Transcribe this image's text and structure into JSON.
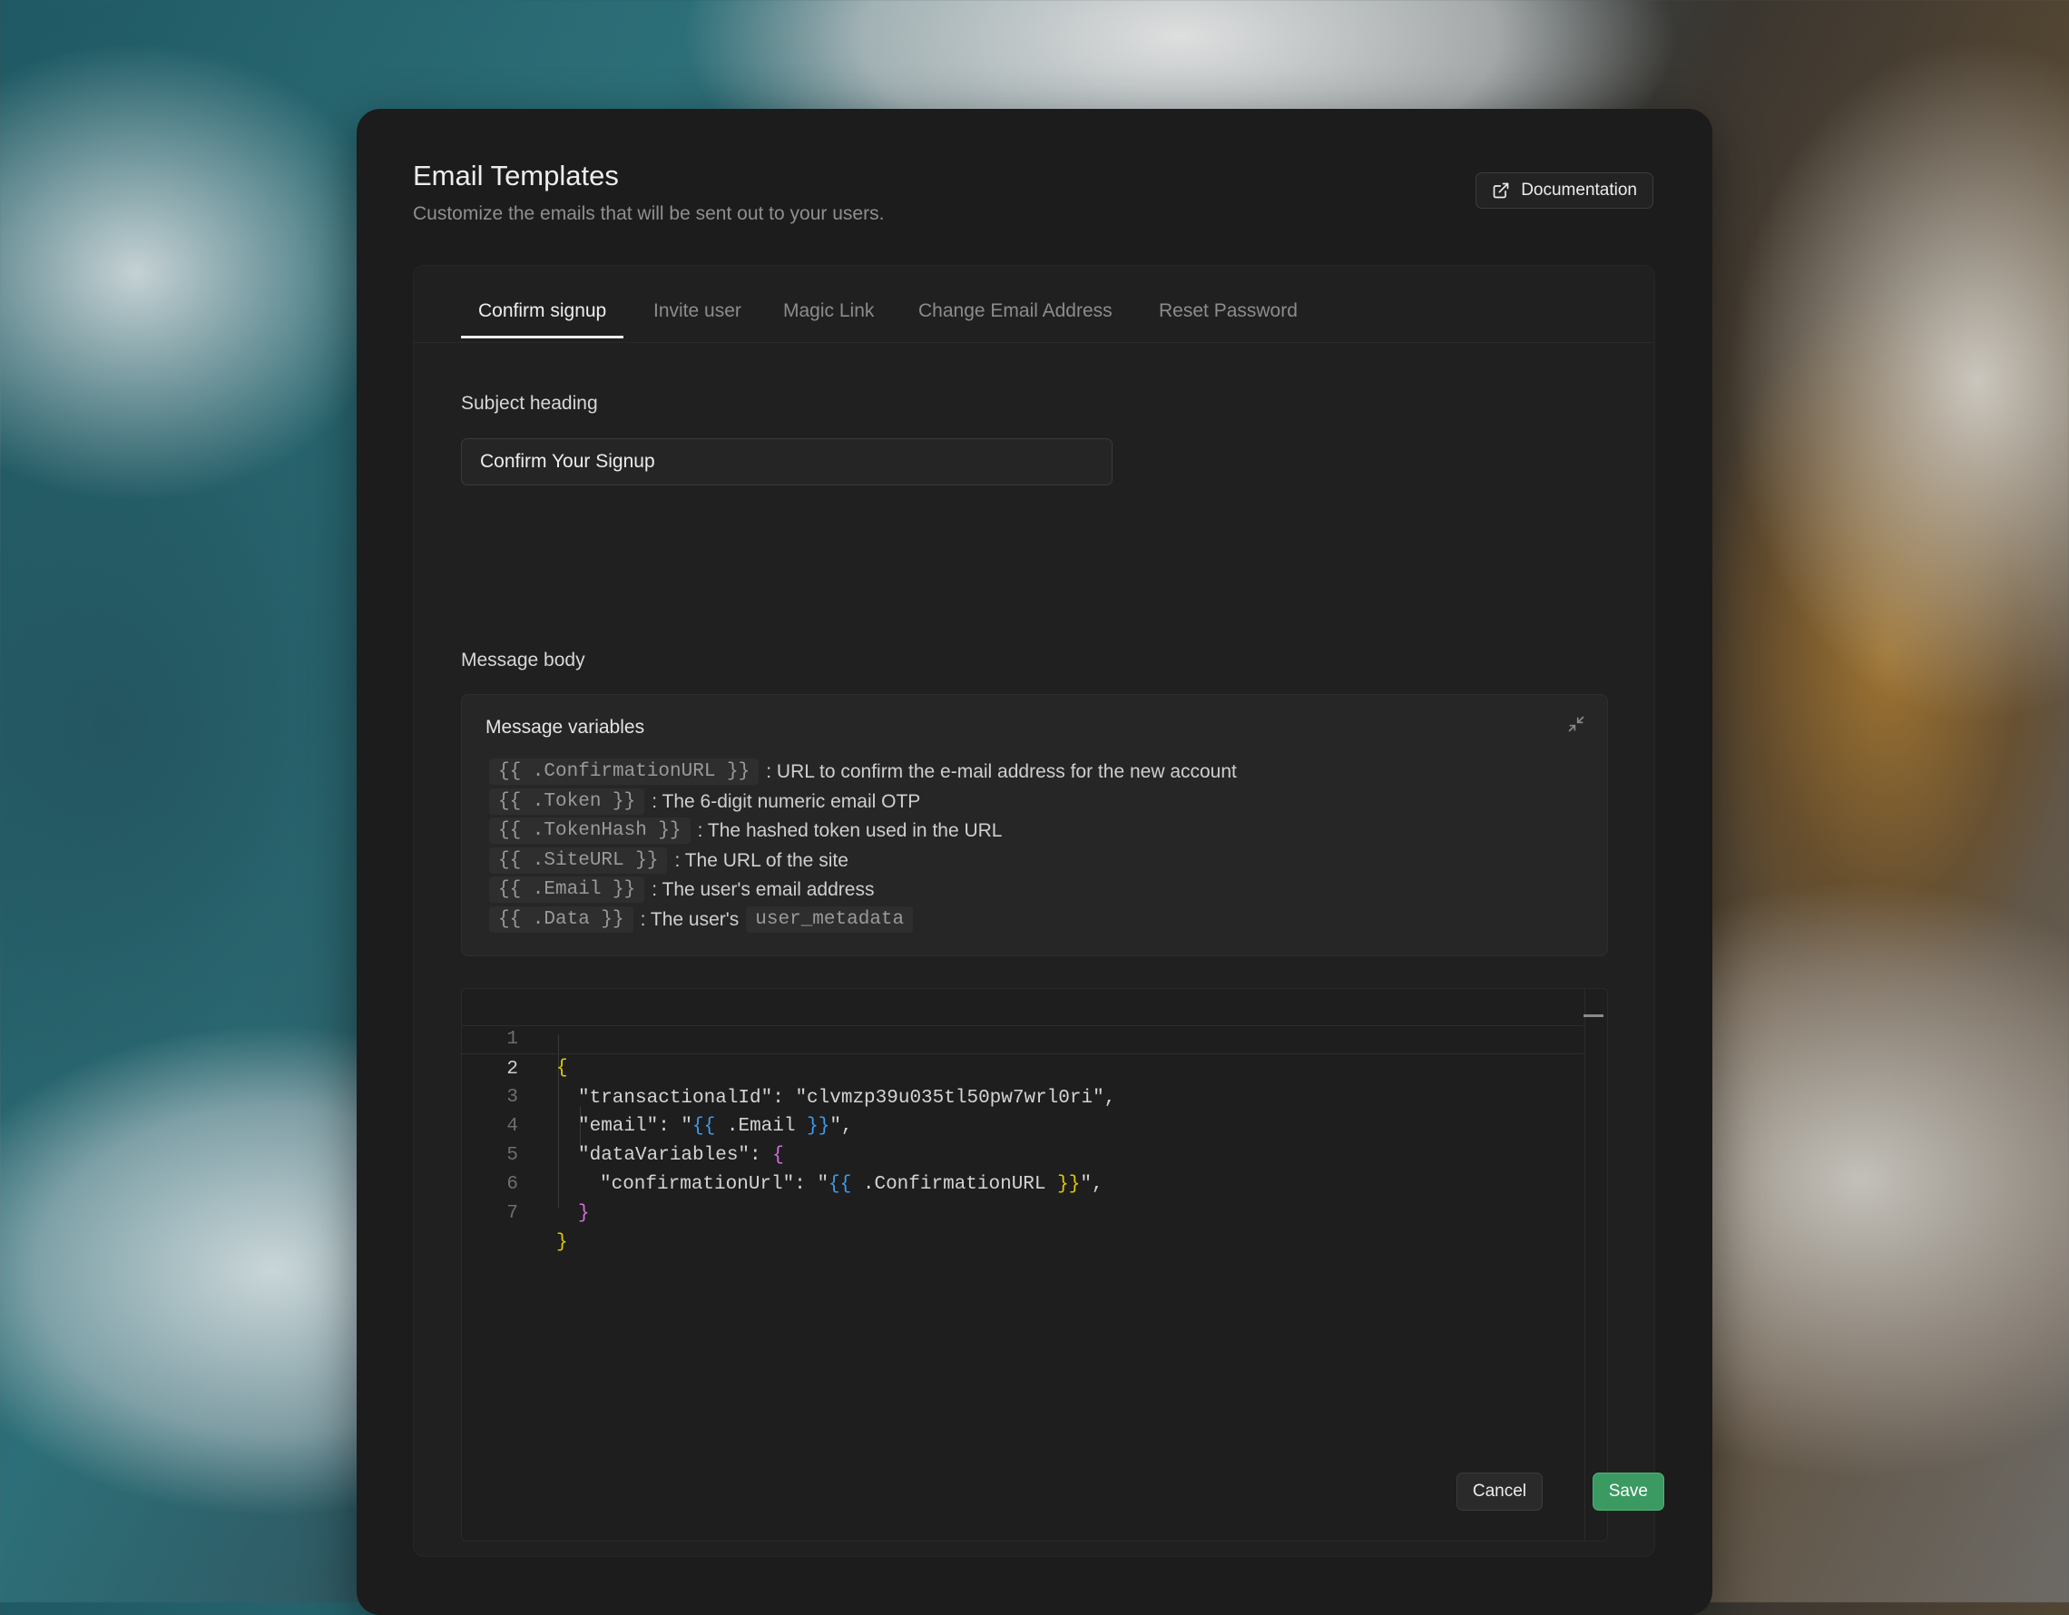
{
  "header": {
    "title": "Email Templates",
    "subtitle": "Customize the emails that will be sent out to your users.",
    "doc_label": "Documentation"
  },
  "tabs": [
    {
      "label": "Confirm signup",
      "active": true
    },
    {
      "label": "Invite user"
    },
    {
      "label": "Magic Link"
    },
    {
      "label": "Change Email Address"
    },
    {
      "label": "Reset Password"
    }
  ],
  "subject": {
    "label": "Subject heading",
    "value": "Confirm Your Signup"
  },
  "body_label": "Message body",
  "variables": {
    "title": "Message variables",
    "items": [
      {
        "code": "{{ .ConfirmationURL }}",
        "desc": ": URL to confirm the e-mail address for the new account"
      },
      {
        "code": "{{ .Token }}",
        "desc": ": The 6-digit numeric email OTP"
      },
      {
        "code": "{{ .TokenHash }}",
        "desc": ": The hashed token used in the URL"
      },
      {
        "code": "{{ .SiteURL }}",
        "desc": ": The URL of the site"
      },
      {
        "code": "{{ .Email }}",
        "desc": ": The user's email address"
      },
      {
        "code": "{{ .Data }}",
        "desc": ": The user's",
        "code2": "user_metadata"
      }
    ]
  },
  "editor": {
    "line_numbers": [
      "1",
      "2",
      "3",
      "4",
      "5",
      "6",
      "7"
    ],
    "current_line": 2,
    "code": {
      "l2_key": "\"transactionalId\": \"clvmzp39u035tl50pw7wrl0ri\",",
      "l3_a": "\"email\": \"",
      "l3_b": ".Email",
      "l3_c": "\",",
      "l4_a": "\"dataVariables\": ",
      "l5_a": "\"confirmationUrl\": \"",
      "l5_b": ".ConfirmationURL",
      "l5_c": "\","
    }
  },
  "footer": {
    "cancel_label": "Cancel",
    "save_label": "Save"
  },
  "colors": {
    "accent_green": "#3a9a62",
    "bracket_yellow": "#e3c800",
    "bracket_purple": "#d46ee0",
    "bracket_blue": "#3d9cf0"
  }
}
